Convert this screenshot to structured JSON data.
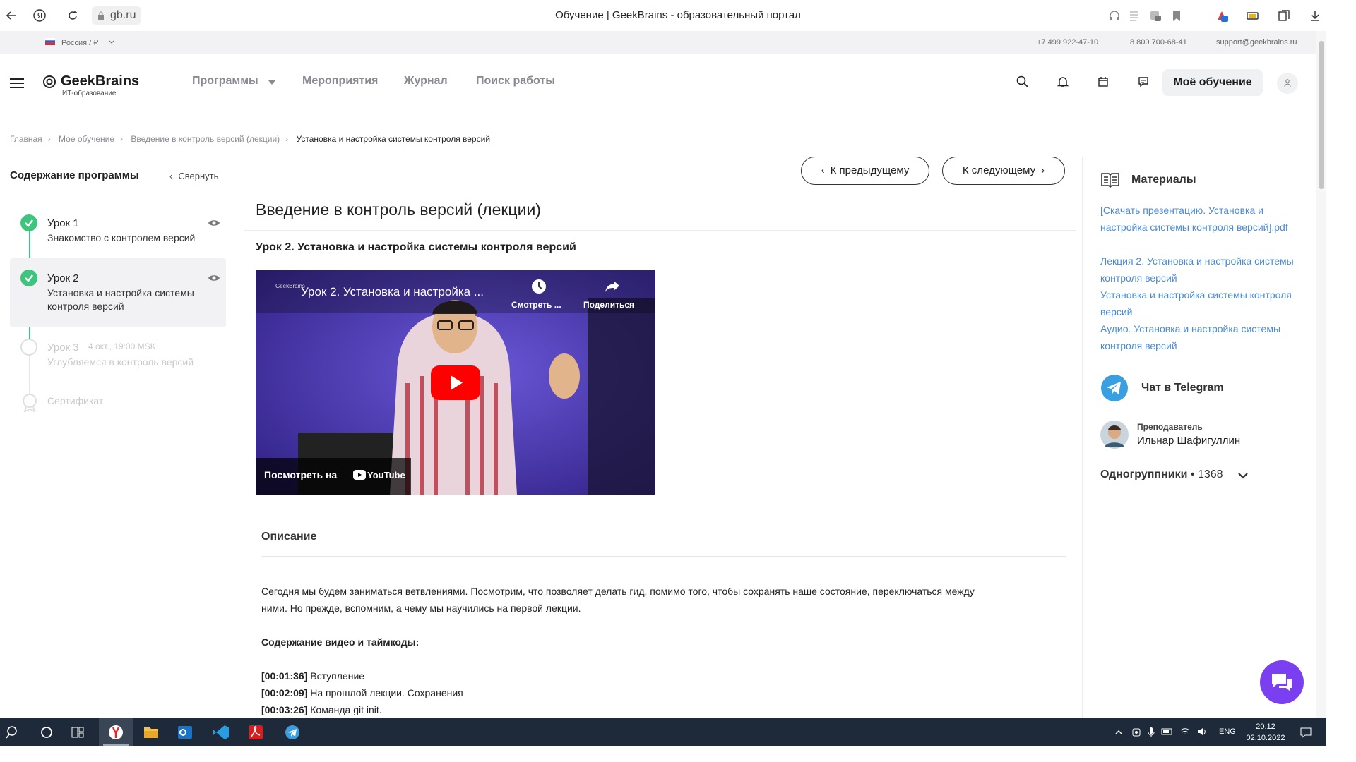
{
  "browser": {
    "address": "gb.ru",
    "tab_title": "Обучение | GeekBrains - образовательный портал"
  },
  "strip": {
    "region": "Россия / ₽",
    "phone1": "+7 499 922-47-10",
    "phone2": "8 800 700-68-41",
    "email": "support@geekbrains.ru"
  },
  "header": {
    "logo": "GeekBrains",
    "logo_sub": "ИТ-образование",
    "menu": [
      "Программы",
      "Мероприятия",
      "Журнал",
      "Поиск работы"
    ],
    "my_learning": "Моё обучение"
  },
  "breadcrumb": [
    "Главная",
    "Мое обучение",
    "Введение в контроль версий (лекции)",
    "Установка и настройка системы контроля версий"
  ],
  "sidebar": {
    "title": "Содержание программы",
    "collapse": "Свернуть",
    "lessons": [
      {
        "num": "Урок 1",
        "desc": "Знакомство с контролем версий"
      },
      {
        "num": "Урок 2",
        "desc": "Установка и настройка системы контроля версий"
      },
      {
        "num": "Урок 3",
        "date": "4 окт., 19:00 MSK",
        "desc": "Углубляемся в контроль версий"
      },
      {
        "num": "Сертификат"
      }
    ]
  },
  "main": {
    "prev": "К предыдущему",
    "next": "К следующему",
    "course_title": "Введение в контроль версий (лекции)",
    "lesson_heading": "Урок 2. Установка и настройка системы контроля версий",
    "video": {
      "title": "Урок 2. Установка и настройка ...",
      "channel": "GeekBrains",
      "watch_later": "Смотреть ...",
      "share": "Поделиться",
      "watch_on": "Посмотреть на",
      "youtube": "YouTube"
    },
    "description_title": "Описание",
    "paragraph": "Сегодня мы будем заниматься ветвлениями. Посмотрим, что позволяет делать гид, помимо того, чтобы сохранять наше состояние, переключаться между",
    "paragraph2": "ними. Но прежде, вспомним, а чему мы научились на первой лекции.",
    "contents_label": "Содержание видео и таймкоды:",
    "timecodes": [
      {
        "time": "[00:01:36]",
        "text": " Вступление"
      },
      {
        "time": "[00:02:09]",
        "text": " На прошлой лекции. Сохранения"
      },
      {
        "time": "[00:03:26]",
        "text": " Команда git init."
      }
    ]
  },
  "right": {
    "materials_title": "Материалы",
    "links": [
      "[Скачать презентацию. Установка и настройка системы контроля версий].pdf",
      "Лекция 2. Установка и настройка системы контроля версий",
      "Установка и настройка системы контроля версий",
      "Аудио. Установка и настройка системы контроля версий"
    ],
    "telegram": "Чат в Telegram",
    "teacher_role": "Преподаватель",
    "teacher_name": "Ильнар Шафигуллин",
    "classmates_label": "Одногруппники",
    "classmates_count": "• 1368"
  },
  "taskbar": {
    "lang": "ENG",
    "time": "20:12",
    "date": "02.10.2022"
  },
  "colors": {
    "accent_green": "#3fc47d",
    "link_blue": "#4a8ad6",
    "chat_purple": "#7b3ff2",
    "telegram_blue": "#3a9fe0"
  }
}
